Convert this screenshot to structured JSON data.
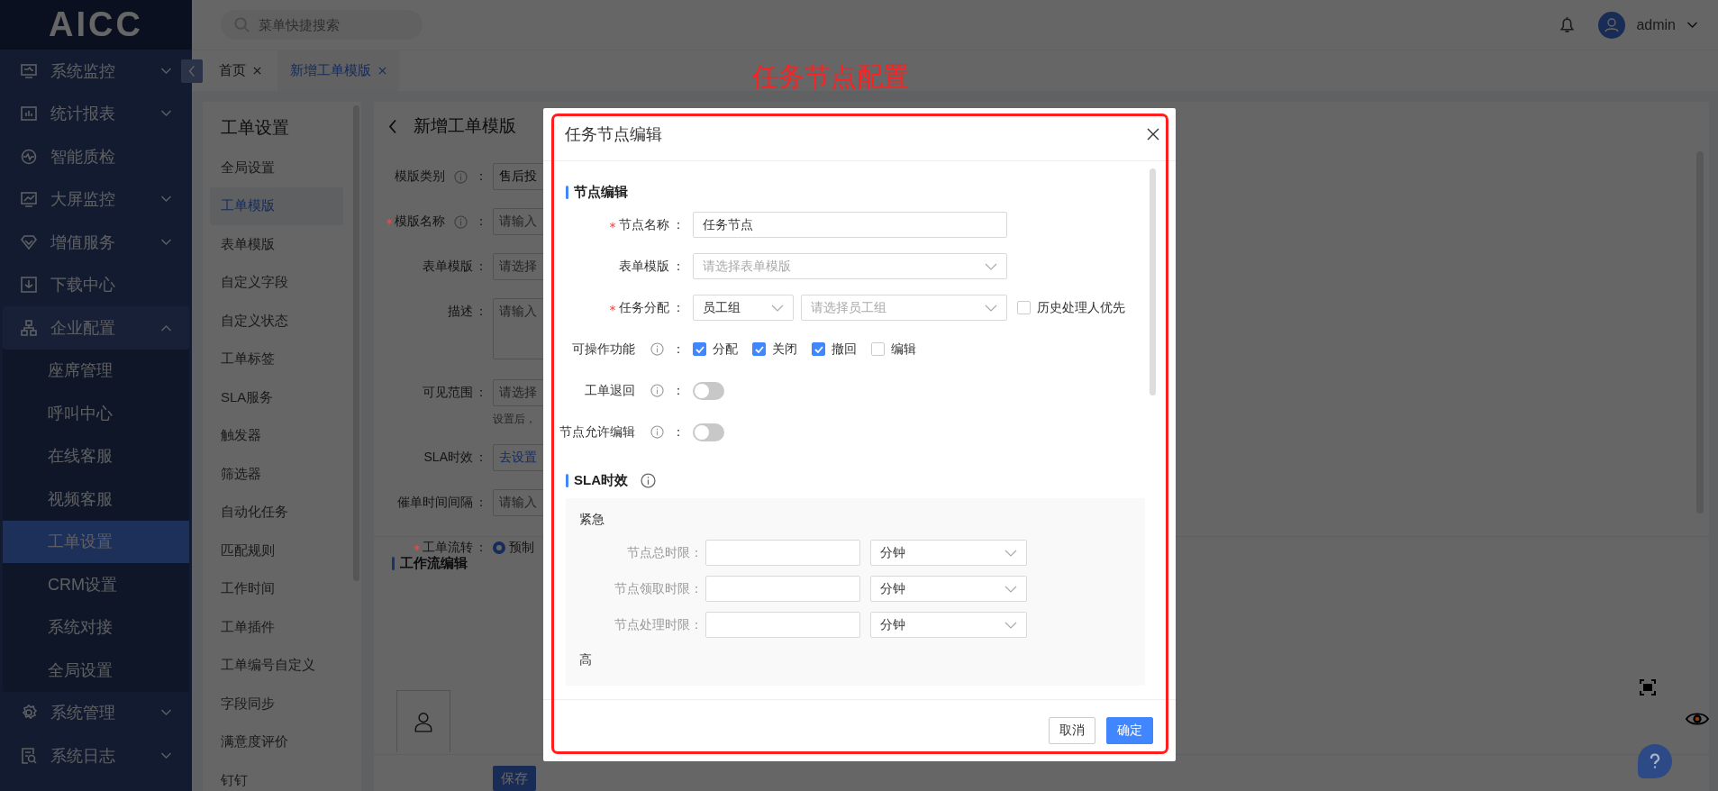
{
  "logo": "AICC",
  "search": {
    "placeholder": "菜单快捷搜索"
  },
  "user": {
    "name": "admin"
  },
  "sidebar": {
    "items": [
      {
        "kind": "group",
        "label": "系统监控",
        "expanded": false
      },
      {
        "kind": "group",
        "label": "统计报表",
        "expanded": false
      },
      {
        "kind": "link",
        "label": "智能质检"
      },
      {
        "kind": "group",
        "label": "大屏监控",
        "expanded": false
      },
      {
        "kind": "group",
        "label": "增值服务",
        "expanded": false
      },
      {
        "kind": "link",
        "label": "下载中心"
      },
      {
        "kind": "group",
        "label": "企业配置",
        "expanded": true,
        "children": [
          {
            "label": "座席管理",
            "selected": false
          },
          {
            "label": "呼叫中心",
            "selected": false
          },
          {
            "label": "在线客服",
            "selected": false
          },
          {
            "label": "视频客服",
            "selected": false
          },
          {
            "label": "工单设置",
            "selected": true
          },
          {
            "label": "CRM设置",
            "selected": false
          },
          {
            "label": "系统对接",
            "selected": false
          },
          {
            "label": "全局设置",
            "selected": false
          }
        ]
      },
      {
        "kind": "group",
        "label": "系统管理",
        "expanded": false
      },
      {
        "kind": "group",
        "label": "系统日志",
        "expanded": false
      }
    ]
  },
  "tabs": [
    {
      "label": "首页",
      "selected": false
    },
    {
      "label": "新增工单模版",
      "selected": true
    }
  ],
  "settings_menu": {
    "title": "工单设置",
    "items": [
      {
        "label": "全局设置",
        "selected": false
      },
      {
        "label": "工单模版",
        "selected": true
      },
      {
        "label": "表单模版",
        "selected": false
      },
      {
        "label": "自定义字段",
        "selected": false
      },
      {
        "label": "自定义状态",
        "selected": false
      },
      {
        "label": "工单标签",
        "selected": false
      },
      {
        "label": "SLA服务",
        "selected": false
      },
      {
        "label": "触发器",
        "selected": false
      },
      {
        "label": "筛选器",
        "selected": false
      },
      {
        "label": "自动化任务",
        "selected": false
      },
      {
        "label": "匹配规则",
        "selected": false
      },
      {
        "label": "工作时间",
        "selected": false
      },
      {
        "label": "工单插件",
        "selected": false
      },
      {
        "label": "工单编号自定义",
        "selected": false
      },
      {
        "label": "字段同步",
        "selected": false
      },
      {
        "label": "满意度评价",
        "selected": false
      },
      {
        "label": "钉钉",
        "selected": false
      }
    ]
  },
  "page": {
    "title": "新增工单模版",
    "fields": [
      {
        "kind": "select",
        "label": "模版类别",
        "colon": "：",
        "required": false,
        "info": true,
        "value": "售后投"
      },
      {
        "kind": "input",
        "label": "模版名称",
        "colon": "：",
        "required": true,
        "info": true,
        "placeholder": "请输入"
      },
      {
        "kind": "select",
        "label": "表单模版",
        "colon": "：",
        "required": false,
        "info": false,
        "placeholder": "请选择"
      },
      {
        "kind": "textarea",
        "label": "描述",
        "colon": "：",
        "required": false,
        "info": false,
        "placeholder": "请输入"
      },
      {
        "kind": "select",
        "label": "可见范围",
        "colon": "：",
        "required": false,
        "info": false,
        "placeholder": "请选择",
        "note": "设置后，"
      },
      {
        "kind": "link",
        "label": "SLA时效",
        "colon": "：",
        "required": false,
        "info": false,
        "value": "去设置"
      },
      {
        "kind": "input",
        "label": "催单时间间隔",
        "colon": "：",
        "required": false,
        "info": false,
        "placeholder": "请输入"
      },
      {
        "kind": "radio",
        "label": "工单流转",
        "colon": "：",
        "required": true,
        "info": false,
        "value": "预制",
        "selected": true
      }
    ],
    "workflow_title": "工作流编辑",
    "save_button": "保存"
  },
  "modal": {
    "annotation": "任务节点配置",
    "title": "任务节点编辑",
    "node_section": {
      "title": "节点编辑",
      "fields": [
        {
          "kind": "input",
          "label": "节点名称",
          "colon": "：",
          "required": true,
          "info": false,
          "value": "任务节点"
        },
        {
          "kind": "select",
          "label": "表单模版",
          "colon": "：",
          "required": false,
          "info": false,
          "placeholder": "请选择表单模版"
        },
        {
          "kind": "assign",
          "label": "任务分配",
          "colon": "：",
          "required": true,
          "info": false,
          "value": "员工组",
          "placeholder": "请选择员工组",
          "option": {
            "label": "历史处理人优先",
            "checked": false
          }
        },
        {
          "kind": "checks",
          "label": "可操作功能",
          "colon": "：",
          "required": false,
          "info": true,
          "options": [
            {
              "label": "分配",
              "checked": true
            },
            {
              "label": "关闭",
              "checked": true
            },
            {
              "label": "撤回",
              "checked": true
            },
            {
              "label": "编辑",
              "checked": false
            }
          ]
        },
        {
          "kind": "switch",
          "label": "工单退回",
          "colon": "：",
          "required": false,
          "info": true,
          "on": false
        },
        {
          "kind": "switch",
          "label": "节点允许编辑",
          "colon": "：",
          "required": false,
          "info": true,
          "on": false
        }
      ]
    },
    "sla_section": {
      "title": "SLA时效",
      "info": true,
      "levels": [
        {
          "name": "紧急",
          "limits": [
            {
              "label": "节点总时限：",
              "unit": "分钟"
            },
            {
              "label": "节点领取时限：",
              "unit": "分钟"
            },
            {
              "label": "节点处理时限：",
              "unit": "分钟"
            }
          ]
        },
        {
          "name": "高"
        }
      ]
    },
    "buttons": [
      {
        "label": "取消",
        "kind": "default"
      },
      {
        "label": "确定",
        "kind": "primary"
      }
    ]
  }
}
